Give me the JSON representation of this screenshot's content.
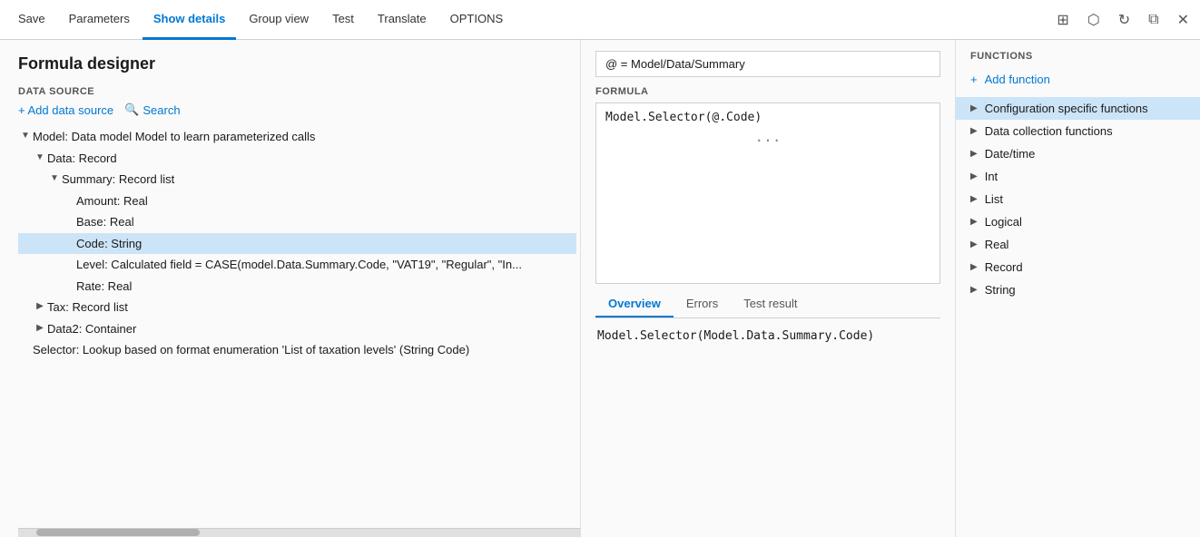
{
  "window": {
    "title": "Formula designer"
  },
  "topbar": {
    "tabs": [
      {
        "id": "save",
        "label": "Save",
        "active": false
      },
      {
        "id": "parameters",
        "label": "Parameters",
        "active": false
      },
      {
        "id": "show-details",
        "label": "Show details",
        "active": true
      },
      {
        "id": "group-view",
        "label": "Group view",
        "active": false
      },
      {
        "id": "test",
        "label": "Test",
        "active": false
      },
      {
        "id": "translate",
        "label": "Translate",
        "active": false
      },
      {
        "id": "options",
        "label": "OPTIONS",
        "active": false
      }
    ],
    "icons": [
      "network-icon",
      "office-icon",
      "refresh-icon",
      "resize-icon",
      "close-icon"
    ]
  },
  "datasource": {
    "section_label": "DATA SOURCE",
    "add_label": "+ Add data source",
    "search_label": "Search"
  },
  "tree": {
    "items": [
      {
        "indent": 1,
        "expander": "▼",
        "label": "Model: Data model Model to learn parameterized calls",
        "selected": false
      },
      {
        "indent": 2,
        "expander": "▼",
        "label": "Data: Record",
        "selected": false
      },
      {
        "indent": 3,
        "expander": "▼",
        "label": "Summary: Record list",
        "selected": false
      },
      {
        "indent": 4,
        "expander": "",
        "label": "Amount: Real",
        "selected": false
      },
      {
        "indent": 4,
        "expander": "",
        "label": "Base: Real",
        "selected": false
      },
      {
        "indent": 4,
        "expander": "",
        "label": "Code: String",
        "selected": true
      },
      {
        "indent": 4,
        "expander": "",
        "label": "Level: Calculated field = CASE(model.Data.Summary.Code, \"VAT19\", \"Regular\", \"In...",
        "selected": false
      },
      {
        "indent": 4,
        "expander": "",
        "label": "Rate: Real",
        "selected": false
      },
      {
        "indent": 2,
        "expander": "▶",
        "label": "Tax: Record list",
        "selected": false
      },
      {
        "indent": 2,
        "expander": "▶",
        "label": "Data2: Container",
        "selected": false
      },
      {
        "indent": 1,
        "expander": "",
        "label": "Selector: Lookup based on format enumeration 'List of taxation levels' (String Code)",
        "selected": false
      }
    ]
  },
  "formula": {
    "path_label": "@ = Model/Data/Summary",
    "section_label": "FORMULA",
    "formula_text": "Model.Selector(@.Code)",
    "tabs": [
      {
        "id": "overview",
        "label": "Overview",
        "active": true
      },
      {
        "id": "errors",
        "label": "Errors",
        "active": false
      },
      {
        "id": "test-result",
        "label": "Test result",
        "active": false
      }
    ],
    "result_text": "Model.Selector(Model.Data.Summary.Code)",
    "dots": "..."
  },
  "functions": {
    "section_label": "FUNCTIONS",
    "add_label": "+ Add function",
    "items": [
      {
        "id": "config-specific",
        "label": "Configuration specific functions",
        "selected": true
      },
      {
        "id": "data-collection",
        "label": "Data collection functions",
        "selected": false
      },
      {
        "id": "datetime",
        "label": "Date/time",
        "selected": false
      },
      {
        "id": "int",
        "label": "Int",
        "selected": false
      },
      {
        "id": "list",
        "label": "List",
        "selected": false
      },
      {
        "id": "logical",
        "label": "Logical",
        "selected": false
      },
      {
        "id": "real",
        "label": "Real",
        "selected": false
      },
      {
        "id": "record",
        "label": "Record",
        "selected": false
      },
      {
        "id": "string",
        "label": "String",
        "selected": false
      }
    ]
  }
}
